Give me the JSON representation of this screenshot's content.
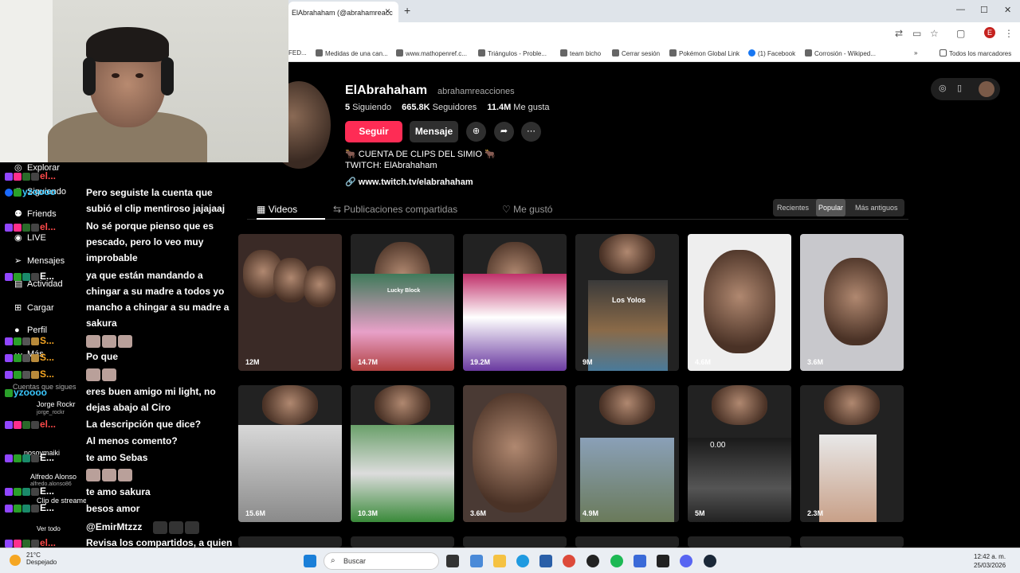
{
  "browser": {
    "tab_title": "ElAbrahaham (@abrahamreacc",
    "tab_close": "×",
    "new_tab": "+",
    "window_controls": [
      "—",
      "☐",
      "✕"
    ],
    "bookmarks": [
      "FED...",
      "Medidas de una can...",
      "www.mathopenref.c...",
      "Triángulos - Proble...",
      "team bicho",
      "Cerrar sesión",
      "Pokémon Global Link",
      "(1) Facebook",
      "Corrosión - Wikiped...",
      "»",
      "Todos los marcadores"
    ],
    "profile_initial": "E"
  },
  "profile": {
    "name": "ElAbrahaham",
    "handle": "abrahamreacciones",
    "following_count": "5",
    "following_label": "Siguiendo",
    "followers_count": "665.8K",
    "followers_label": "Seguidores",
    "likes_count": "11.4M",
    "likes_label": "Me gusta",
    "follow_button": "Seguir",
    "message_button": "Mensaje",
    "bio_line1": "🐂 CUENTA DE CLIPS DEL SIMIO 🐂",
    "bio_line2": "TWITCH: ElAbrahaham",
    "bio_link": "www.twitch.tv/elabrahaham"
  },
  "tabs": {
    "videos": "Videos",
    "shared": "Publicaciones compartidas",
    "liked": "Me gustó"
  },
  "sort": {
    "recent": "Recientes",
    "popular": "Popular",
    "oldest": "Más antiguos"
  },
  "videos": [
    {
      "views": "12M"
    },
    {
      "views": "14.7M"
    },
    {
      "views": "19.2M"
    },
    {
      "views": "9M"
    },
    {
      "views": "4.6M"
    },
    {
      "views": "3.6M"
    },
    {
      "views": "15.6M"
    },
    {
      "views": "10.3M"
    },
    {
      "views": "3.6M"
    },
    {
      "views": "4.9M"
    },
    {
      "views": "5M"
    },
    {
      "views": "2.3M"
    }
  ],
  "thumb_texts": {
    "lucky_block": "Lucky Block",
    "los_yolos": "Los Yolos",
    "timer": "0.00"
  },
  "sidebar": {
    "explore": "Explorar",
    "following": "Siguiendo",
    "friends": "Friends",
    "live": "LIVE",
    "messages": "Mensajes",
    "activity": "Actividad",
    "upload": "Cargar",
    "profile": "Perfil",
    "more": "Más",
    "followed_accounts": "Cuentas que sigues",
    "account1_name": "Jorge Rockr",
    "account1_handle": "jorge_rockr",
    "account2_name": "nosoymaiki",
    "account3_name": "Alfredo Alonso",
    "account3_handle": "alfredo.alonso86",
    "clip_streamer": "Clip de streamer",
    "see_all": "Ver todo"
  },
  "chat": {
    "usernames": [
      "el...",
      "yzoooo",
      "el...",
      "E...",
      "S...",
      "S...",
      "S...",
      "yzoooo",
      "el...",
      "E...",
      "E...",
      "E...",
      "el..."
    ],
    "messages": [
      "Pero seguiste la cuenta que subió el clip mentiroso jajajaaj",
      "No sé porque pienso que es pescado, pero lo veo muy improbable",
      "ya que están mandando a chingar a su madre a todos yo mancho a chingar a su madre a sakura",
      "Po que",
      "eres buen amigo mi light, no dejas abajo al Ciro",
      "La descripción que dice?",
      "Al menos comento?",
      "te amo Sebas",
      "te amo sakura",
      "besos amor",
      "@EmirMtzzz",
      "Revisa los compartidos, a quien sigue, todo eso"
    ]
  },
  "taskbar": {
    "temperature": "21°C",
    "weather": "Despejado",
    "search": "Buscar",
    "time": "12:42 a. m.",
    "date": "25/03/2026"
  }
}
